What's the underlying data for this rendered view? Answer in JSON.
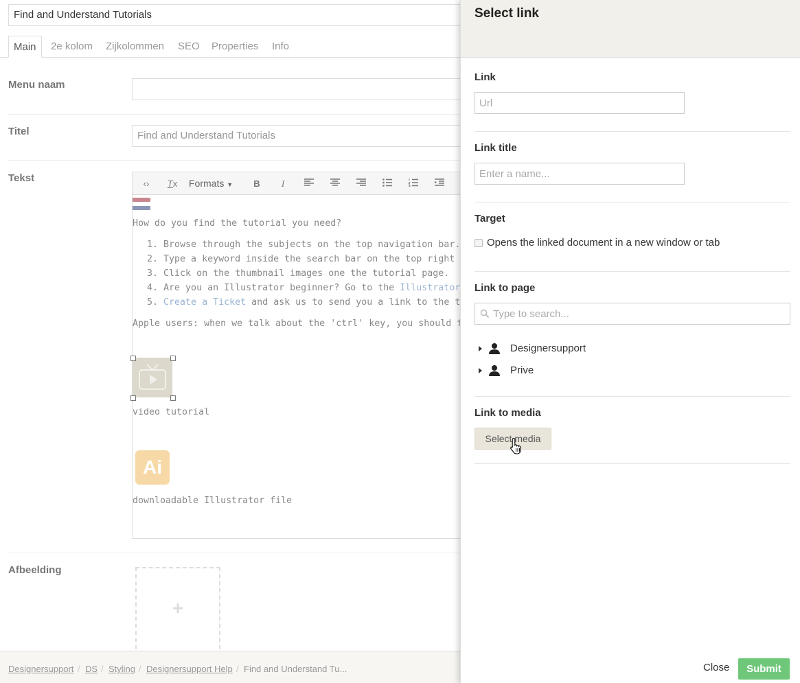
{
  "editor": {
    "node_name": "Find and Understand Tutorials",
    "tabs": [
      {
        "label": "Main"
      },
      {
        "label": "2e kolom"
      },
      {
        "label": "Zijkolommen"
      },
      {
        "label": "SEO"
      },
      {
        "label": "Properties"
      },
      {
        "label": "Info"
      }
    ],
    "active_tab": "Main",
    "menu_naam": {
      "label": "Menu naam",
      "value": ""
    },
    "titel": {
      "label": "Titel",
      "value": "Find and Understand Tutorials"
    },
    "tekst": {
      "label": "Tekst",
      "toolbar": {
        "formats_label": "Formats"
      },
      "intro": "How do you find the tutorial you need?",
      "list": [
        {
          "num": "1.",
          "text": "Browse through the subjects on the top navigation bar."
        },
        {
          "num": "2.",
          "text": "Type a keyword inside the search bar on the top right of this w"
        },
        {
          "num": "3.",
          "text": "Click on the thumbnail images one the tutorial page."
        },
        {
          "num": "4.",
          "text": "Are you an Illustrator beginner? Go to the ",
          "link": "Illustrator beginner"
        },
        {
          "num": "5.",
          "link": "Create a Ticket",
          "text": " and ask us to send you a link to the tutorial yo"
        }
      ],
      "apple_note": "Apple users: when we talk about the 'ctrl' key, you should translate",
      "video_caption": "video tutorial",
      "ai_caption": "downloadable Illustrator file",
      "ai_icon_text": "Ai"
    },
    "afbeelding": {
      "label": "Afbeelding",
      "plus": "+"
    }
  },
  "breadcrumb": {
    "items": [
      "Designersupport",
      "DS",
      "Styling",
      "Designersupport Help"
    ],
    "separator": "/",
    "current": "Find and Understand Tu..."
  },
  "dialog": {
    "title": "Select link",
    "link": {
      "label": "Link",
      "placeholder": "Url"
    },
    "link_title": {
      "label": "Link title",
      "placeholder": "Enter a name..."
    },
    "target": {
      "label": "Target",
      "checkbox_label": "Opens the linked document in a new window or tab",
      "checked": false
    },
    "link_to_page": {
      "label": "Link to page",
      "search_placeholder": "Type to search...",
      "tree": [
        {
          "label": "Designersupport"
        },
        {
          "label": "Prive"
        }
      ]
    },
    "link_to_media": {
      "label": "Link to media",
      "button": "Select media"
    },
    "close": "Close",
    "submit": "Submit"
  },
  "colors": {
    "header_bg": "#f2f0ea",
    "submit_green": "#6fc77a",
    "media_button_bg": "#e9e5da",
    "link_blue": "#9ab4d0"
  }
}
